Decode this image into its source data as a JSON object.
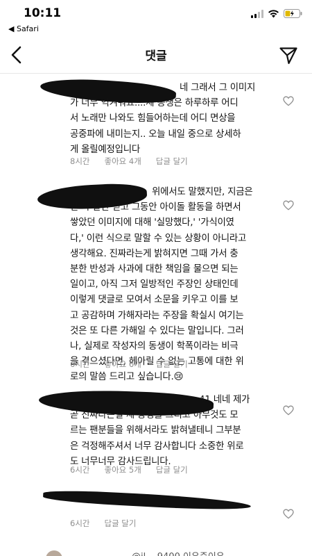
{
  "status_bar": {
    "time": "10:11",
    "back_app": "◀ Safari"
  },
  "nav": {
    "title": "댓글"
  },
  "comments": [
    {
      "lines": [
        "네 그래서 그 이미지",
        "가 너무 역겨워요....제 동생은 하루하루 어디",
        "서 노래만 나와도 힘들어하는데 어디 면상을",
        "공중파에 내미는지.. 오늘 내일 중으로 상세하",
        "게 올릴예정입니다"
      ],
      "time": "8시간",
      "likes": "좋아요 4개",
      "reply": "답글 달기"
    },
    {
      "lines": [
        "위에서도 말했지만, 지금은",
        "한 쪽 말만 믿고 그동안 아이돌 활동을 하면서",
        "쌓았던 이미지에 대해 '실망했다,' '가식이였",
        "다,' 이런 식으로 말할 수 있는 상황이 아니라고",
        "생각해요. 진짜라는게 밝혀지면 그때 가서 충",
        "분한 반성과 사과에 대한 책임을 물으면 되는",
        "일이고, 아직 그저 일방적인 주장인 상태인데",
        "이렇게 댓글로 모여서 소문을 키우고 이를 보",
        "고 공감하며 가해자라는 주장을 확실시 여기는",
        "것은 또 다른 가해일 수 있다는 말입니다. 그러",
        "나, 실제로 작성자의 동생이 학폭이라는 비극",
        "을 겪으셨다면, 헤아릴 수 없는 고통에 대한 위",
        "로의 말씀 드리고 싶습니다.😢"
      ],
      "time": "6시간",
      "likes": "좋아요 6개",
      "reply": "답글 달기"
    },
    {
      "lines": [
        "41 네네 제가",
        "곧 진짜라는걸 제 동생을 그리고 아무것도 모",
        "르는 팬분들을 위해서라도 밝혀낼테니 그부분",
        "은 걱정해주셔서 너무 감사합니다 소중한 위로",
        "도 너무너무 감사드립니다."
      ],
      "time": "6시간",
      "likes": "좋아요 5개",
      "reply": "답글 달기"
    },
    {
      "lines": [],
      "time": "6시간",
      "likes": "",
      "reply": "답글 달기"
    }
  ],
  "bottom_partial_text": "@il... 9400 이유준이유",
  "colors": {
    "text": "#111111",
    "meta": "#8e8e8e",
    "redaction": "#101010"
  },
  "icons": [
    "back-chevron-icon",
    "send-icon",
    "heart-icon",
    "wifi-icon",
    "signal-icon",
    "battery-icon"
  ]
}
